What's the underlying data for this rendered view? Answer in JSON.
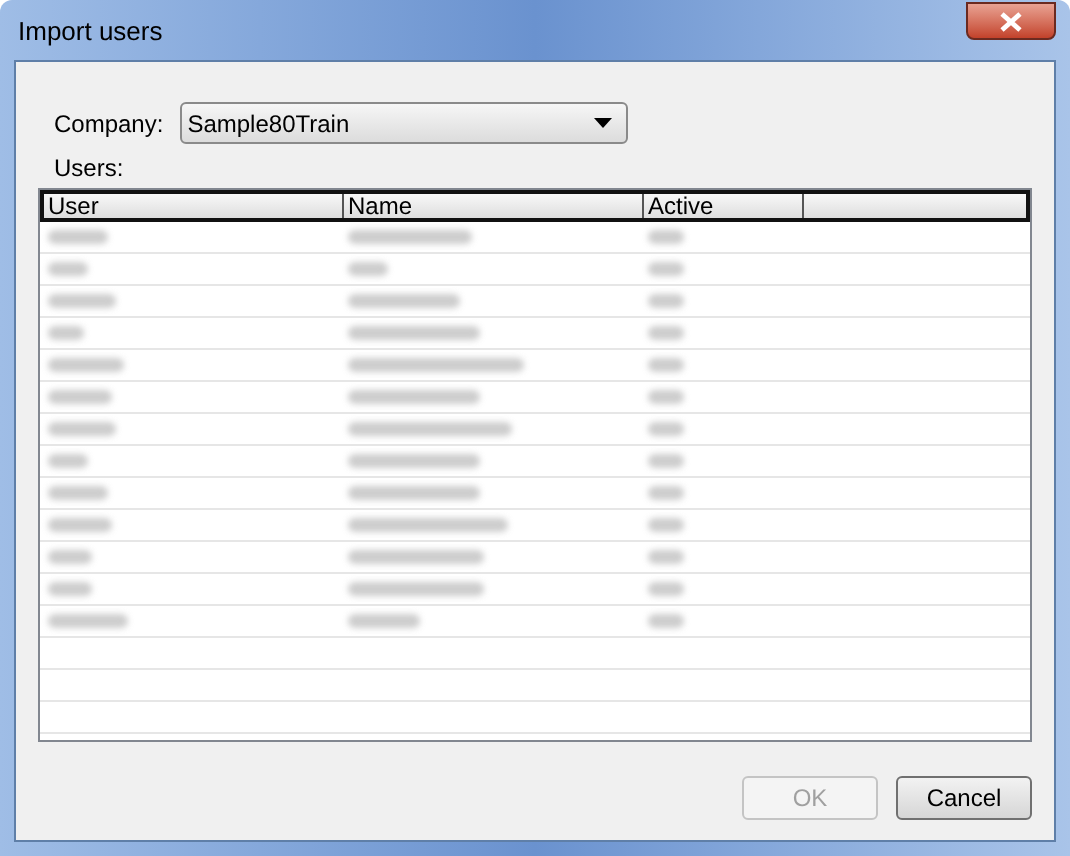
{
  "window": {
    "title": "Import users"
  },
  "company": {
    "label": "Company:",
    "value": "Sample80Train"
  },
  "users_label": "Users:",
  "table": {
    "columns": [
      "User",
      "Name",
      "Active"
    ],
    "rows": [
      {
        "kind": "blurred"
      },
      {
        "kind": "blurred"
      },
      {
        "kind": "blurred"
      },
      {
        "kind": "blurred"
      },
      {
        "kind": "blurred"
      },
      {
        "kind": "blurred"
      },
      {
        "kind": "blurred"
      },
      {
        "kind": "blurred"
      },
      {
        "kind": "blurred"
      },
      {
        "kind": "blurred"
      },
      {
        "kind": "blurred"
      },
      {
        "kind": "blurred"
      },
      {
        "kind": "blurred"
      },
      {
        "kind": "empty"
      },
      {
        "kind": "empty"
      },
      {
        "kind": "empty"
      }
    ]
  },
  "buttons": [
    {
      "label": "OK",
      "disabled": true
    },
    {
      "label": "Cancel",
      "disabled": false
    }
  ]
}
